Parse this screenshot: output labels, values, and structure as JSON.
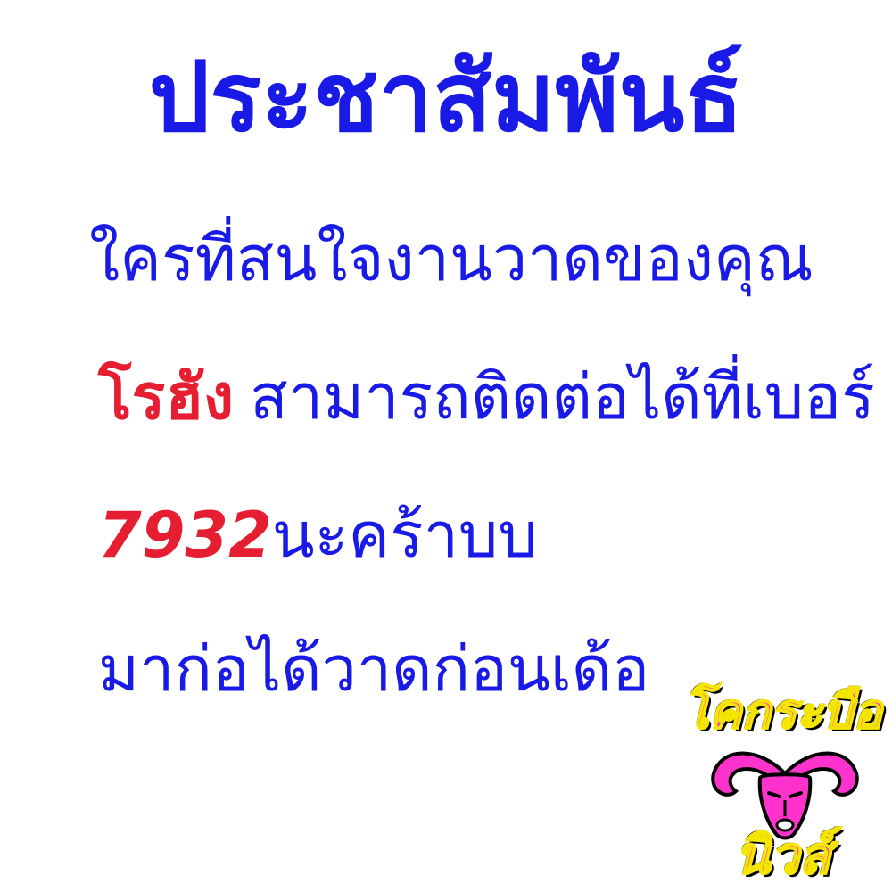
{
  "title": "ประชาสัมพันธ์",
  "lines": {
    "line1": "ใครที่สนใจงานวาดของคุณ",
    "line2_name": "โรฮัง",
    "line2_rest": "สามารถติดต่อได้ที่เบอร์",
    "line3_number": "7932",
    "line3_rest": "นะคร้าบบ",
    "line4": "มาก่อได้วาดก่อนเด้อ"
  },
  "logo": {
    "top_text": "โคกระบือ",
    "bottom_text": "นิวส์",
    "icon": "buffalo-head-icon"
  },
  "colors": {
    "background": "#ffffff",
    "main_text": "#1a1ae6",
    "highlight_text": "#e61e32",
    "logo_fill": "#ff33cc",
    "logo_outline": "#f4e600"
  }
}
